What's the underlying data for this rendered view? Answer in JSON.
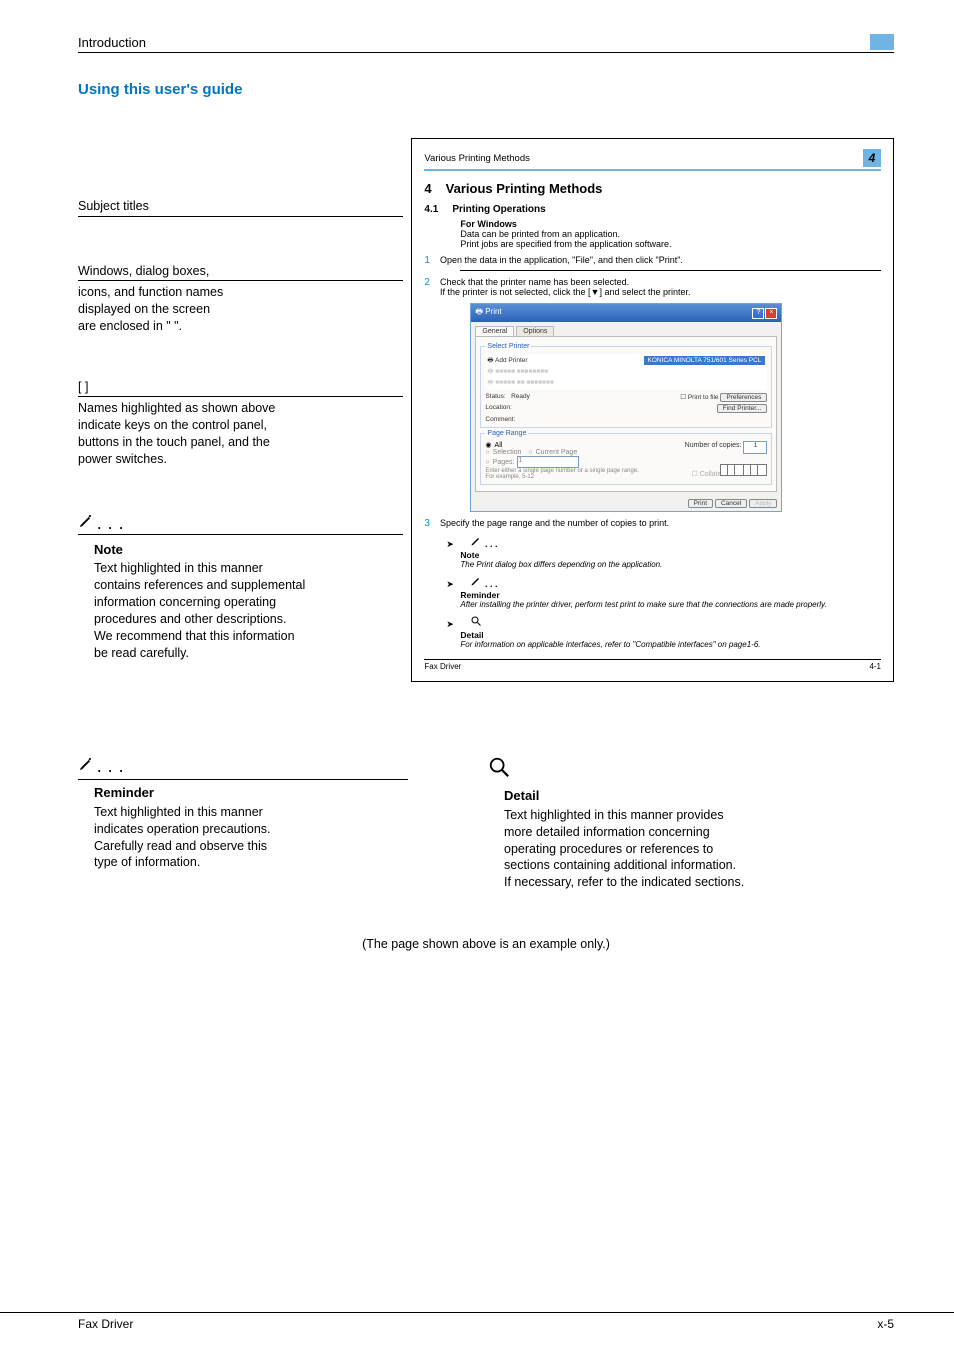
{
  "header": {
    "left": "Introduction"
  },
  "section_title": "Using this user's guide",
  "callouts": {
    "subject": {
      "label": "Subject titles"
    },
    "quotes": {
      "lines": [
        "Windows, dialog boxes,",
        "icons, and function names",
        "displayed on the screen",
        "are enclosed in \" \"."
      ]
    },
    "brackets": {
      "symbol": "[  ]",
      "lines": [
        "Names highlighted as shown above",
        "indicate keys on the control panel,",
        "buttons in the touch panel, and the",
        "power switches."
      ]
    },
    "note": {
      "heading": "Note",
      "lines": [
        "Text highlighted in this manner",
        "contains references and supplemental",
        "information concerning operating",
        "procedures and other descriptions.",
        "We recommend that this information",
        "be read carefully."
      ]
    }
  },
  "example": {
    "running_head": "Various Printing Methods",
    "running_num": "4",
    "ch_num": "4",
    "ch_title": "Various Printing Methods",
    "sub_num": "4.1",
    "sub_title": "Printing Operations",
    "for_win": "For Windows",
    "intro1": "Data can be printed from an application.",
    "intro2": "Print jobs are specified from the application software.",
    "step1": {
      "n": "1",
      "txt": "Open the data in the application, \"File\", and then click \"Print\"."
    },
    "step2": {
      "n": "2",
      "l1": "Check that the printer name has been selected.",
      "l2": "If the printer is not selected, click the [▼] and select the printer."
    },
    "dialog": {
      "title": "Print",
      "tab1": "General",
      "tab2": "Options",
      "grp1": "Select Printer",
      "addp": "Add Printer",
      "selp": "KONICA MINOLTA 751/601 Series PCL",
      "status_l": "Status:",
      "status_v": "Ready",
      "loc": "Location:",
      "com": "Comment:",
      "ptf": "Print to file",
      "pref": "Preferences",
      "findp": "Find Printer...",
      "grp2": "Page Range",
      "all": "All",
      "selr": "Selection",
      "curp": "Current Page",
      "pages": "Pages:",
      "pages_v": "1",
      "hint": "Enter either a single page number or a single page range. For example, 5-12",
      "ncopies": "Number of copies:",
      "ncopies_v": "1",
      "collate": "Collate",
      "print": "Print",
      "cancel": "Cancel",
      "apply": "Apply"
    },
    "step3": {
      "n": "3",
      "txt": "Specify the page range and the number of copies to print."
    },
    "noteblock": {
      "h": "Note",
      "t": "The Print dialog box differs depending on the application."
    },
    "remblock": {
      "h": "Reminder",
      "t": "After installing the printer driver, perform test print to make sure that the connections are made properly."
    },
    "detailblock": {
      "h": "Detail",
      "t": "For information on applicable interfaces, refer to \"Compatible interfaces\" on page1-6."
    },
    "foot_l": "Fax Driver",
    "foot_r": "4-1"
  },
  "lower": {
    "reminder": {
      "h": "Reminder",
      "lines": [
        "Text highlighted in this manner",
        "indicates operation precautions.",
        "Carefully read and observe this",
        "type of information."
      ]
    },
    "detail": {
      "h": "Detail",
      "lines": [
        "Text highlighted in this manner provides",
        "more detailed information concerning",
        "operating procedures or references to",
        "sections containing additional information.",
        "If necessary, refer to the indicated sections."
      ]
    }
  },
  "conclusion": "(The page shown above is an example only.)",
  "footer": {
    "left": "Fax Driver",
    "right": "x-5"
  }
}
